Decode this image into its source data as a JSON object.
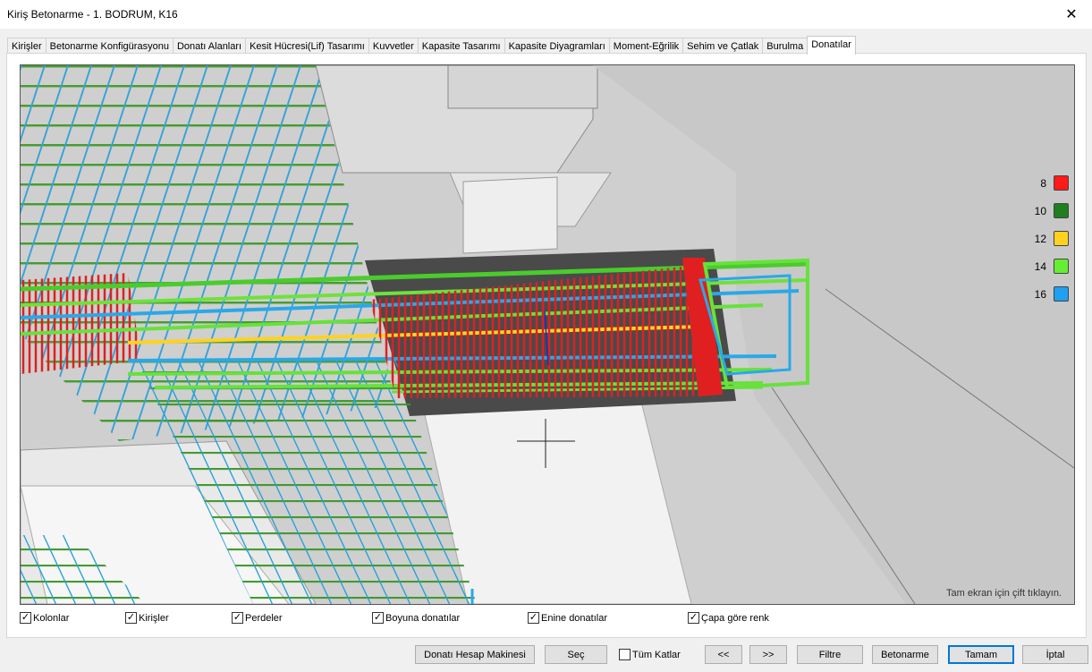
{
  "window": {
    "title": "Kiriş Betonarme - 1. BODRUM, K16"
  },
  "tabs": [
    {
      "label": "Kirişler"
    },
    {
      "label": "Betonarme Konfigürasyonu"
    },
    {
      "label": "Donatı Alanları"
    },
    {
      "label": "Kesit Hücresi(Lif) Tasarımı"
    },
    {
      "label": "Kuvvetler"
    },
    {
      "label": "Kapasite Tasarımı"
    },
    {
      "label": "Kapasite Diyagramları"
    },
    {
      "label": "Moment-Eğrilik"
    },
    {
      "label": "Sehim ve Çatlak"
    },
    {
      "label": "Burulma"
    },
    {
      "label": "Donatılar"
    }
  ],
  "active_tab": "Donatılar",
  "viewport": {
    "hint": "Tam ekran için çift tıklayın."
  },
  "legend": [
    {
      "label": "8",
      "color": "#ff1a1a"
    },
    {
      "label": "10",
      "color": "#1e7f1e"
    },
    {
      "label": "12",
      "color": "#ffd21f"
    },
    {
      "label": "14",
      "color": "#66ee33"
    },
    {
      "label": "16",
      "color": "#1fa0f0"
    }
  ],
  "checkboxes": [
    {
      "label": "Kolonlar",
      "checked": true
    },
    {
      "label": "Kirişler",
      "checked": true
    },
    {
      "label": "Perdeler",
      "checked": true
    },
    {
      "label": "Boyuna donatılar",
      "checked": true
    },
    {
      "label": "Enine donatılar",
      "checked": true
    },
    {
      "label": "Çapa göre renk",
      "checked": true
    }
  ],
  "buttons": {
    "calculator": "Donatı Hesap Makinesi",
    "select": "Seç",
    "all_floors": "Tüm Katlar",
    "prev": "<<",
    "next": ">>",
    "filter": "Filtre",
    "concrete": "Betonarme",
    "ok": "Tamam",
    "cancel": "İptal"
  },
  "all_floors_checked": false,
  "close_icon": "close-icon"
}
